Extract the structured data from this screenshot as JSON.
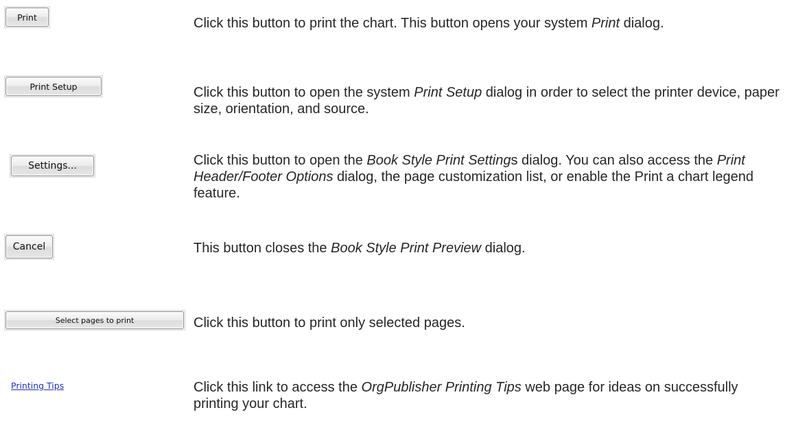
{
  "rows": [
    {
      "button_label": "Print",
      "desc": {
        "p1": "Click this button to print the chart. This button opens your system ",
        "em1": "Print",
        "p2": " dialog."
      }
    },
    {
      "button_label": "Print Setup",
      "desc": {
        "p1": "Click this button to open the system ",
        "em1": "Print Setup",
        "p2": " dialog in order to select the printer device, paper size, orientation, and source."
      }
    },
    {
      "button_label": "Settings...",
      "desc": {
        "p1": "Click this button to open the ",
        "em1": "Book Style Print Setting",
        "p2": "s dialog. You can also access the ",
        "em2": "Print  Header/Footer Options",
        "p3": " dialog, the page customization list, or enable the Print a chart legend feature."
      }
    },
    {
      "button_label": "Cancel",
      "desc": {
        "p1": "This button closes the ",
        "em1": "Book Style Print Preview",
        "p2": " dialog."
      }
    },
    {
      "button_label": "Select pages to print",
      "desc": {
        "p1": "Click this button to print only selected pages."
      }
    },
    {
      "link_label": "Printing Tips",
      "desc": {
        "p1": "Click this link to access the ",
        "em1": "OrgPublisher Printing Tips",
        "p2": " web page for ideas on successfully printing your chart."
      }
    }
  ]
}
